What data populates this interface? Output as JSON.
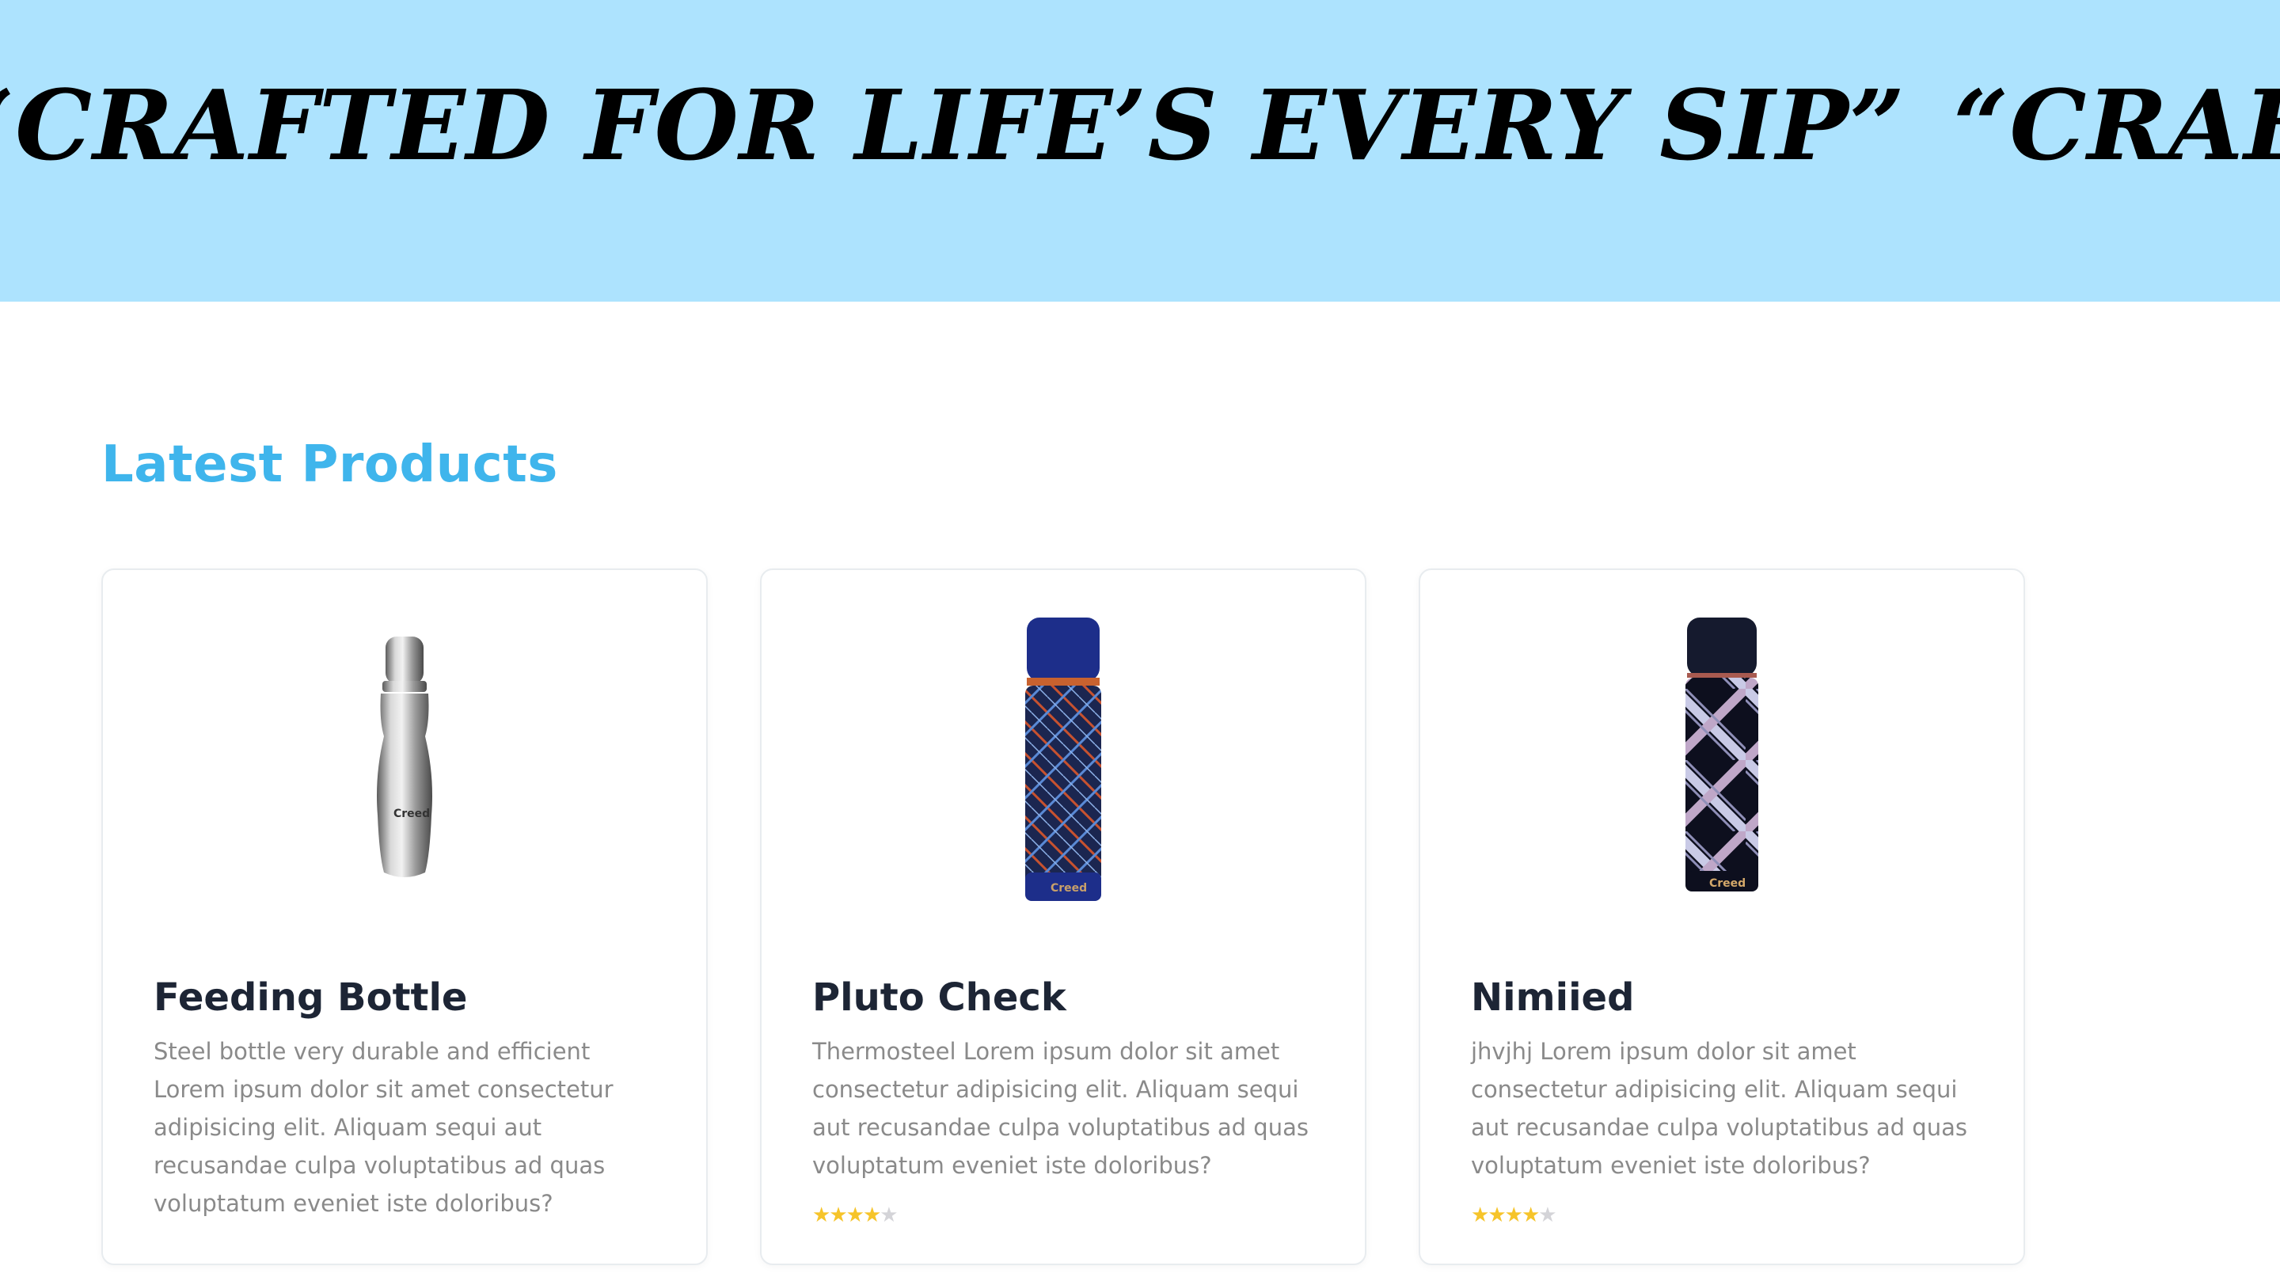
{
  "banner": {
    "background": "#ade3fe",
    "marquee_text_1": "“CRAFTED FOR LIFE’S EVERY SIP”",
    "marquee_text_2": "“CRAFTED FOR LIFE’S EVERY SIP”"
  },
  "section": {
    "title": "Latest Products",
    "title_color": "#3fb5ec"
  },
  "products": [
    {
      "name": "Feeding Bottle",
      "description": "Steel bottle very durable and efficient Lorem ipsum dolor sit amet consectetur adipisicing elit. Aliquam sequi aut recusandae culpa voluptatibus ad quas voluptatum eveniet iste doloribus?",
      "image_icon": "steel-bottle-image",
      "brand_mark": "Creed",
      "rating_visible": false
    },
    {
      "name": "Pluto Check",
      "description": "Thermosteel Lorem ipsum dolor sit amet consectetur adipisicing elit. Aliquam sequi aut recusandae culpa voluptatibus ad quas voluptatum eveniet iste doloribus?",
      "image_icon": "plaid-navy-flask-image",
      "brand_mark": "Creed",
      "rating": 4,
      "rating_max": 5
    },
    {
      "name": "Nimiied",
      "description": "jhvjhj Lorem ipsum dolor sit amet consectetur adipisicing elit. Aliquam sequi aut recusandae culpa voluptatibus ad quas voluptatum eveniet iste doloribus?",
      "image_icon": "plaid-black-flask-image",
      "brand_mark": "Creed",
      "rating": 4,
      "rating_max": 5
    }
  ],
  "colors": {
    "star_filled": "#f6c42a",
    "star_empty": "#d4d4d8",
    "title_text": "#1d2535",
    "body_text": "#8a8a8a"
  }
}
